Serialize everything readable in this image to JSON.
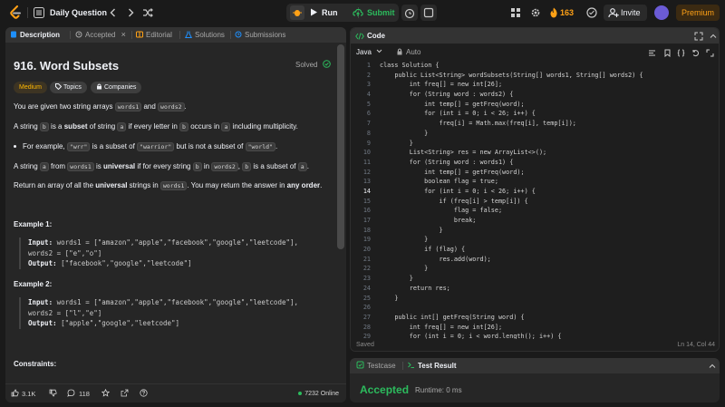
{
  "topbar": {
    "title": "Daily Question",
    "run_label": "Run",
    "submit_label": "Submit",
    "streak": "163",
    "invite_label": "Invite",
    "premium_label": "Premium"
  },
  "left_tabs": [
    {
      "label": "Description"
    },
    {
      "label": "Accepted"
    },
    {
      "label": "Editorial"
    },
    {
      "label": "Solutions"
    },
    {
      "label": "Submissions"
    }
  ],
  "close_glyph": "×",
  "problem": {
    "title": "916. Word Subsets",
    "status": "Solved",
    "difficulty": "Medium",
    "topics_label": "Topics",
    "companies_label": "Companies",
    "p1_a": "You are given two string arrays ",
    "p1_b": "words1",
    "p1_c": " and ",
    "p1_d": "words2",
    "p1_e": ".",
    "p2_a": "A string ",
    "p2_b": "b",
    "p2_c": " is a ",
    "p2_d": "subset",
    "p2_e": " of string ",
    "p2_f": "a",
    "p2_g": " if every letter in ",
    "p2_h": "b",
    "p2_i": " occurs in ",
    "p2_j": "a",
    "p2_k": " including multiplicity.",
    "bullet_a": "For example, ",
    "bullet_b": "\"wrr\"",
    "bullet_c": " is a subset of ",
    "bullet_d": "\"warrior\"",
    "bullet_e": " but is not a subset of ",
    "bullet_f": "\"world\"",
    "bullet_g": ".",
    "p3_a": "A string ",
    "p3_b": "a",
    "p3_c": " from ",
    "p3_d": "words1",
    "p3_e": " is ",
    "p3_f": "universal",
    "p3_g": " if for every string ",
    "p3_h": "b",
    "p3_i": " in ",
    "p3_j": "words2",
    "p3_k": ", ",
    "p3_l": "b",
    "p3_m": " is a subset of ",
    "p3_n": "a",
    "p3_o": ".",
    "p4_a": "Return an array of all the ",
    "p4_b": "universal",
    "p4_c": " strings in ",
    "p4_d": "words1",
    "p4_e": ". You may return the answer in ",
    "p4_f": "any order",
    "p4_g": ".",
    "example1_title": "Example 1:",
    "example1_input_label": "Input:",
    "example1_input_1": " words1 = [\"amazon\",\"apple\",\"facebook\",\"google\",\"leetcode\"],",
    "example1_input_2": "words2 = [\"e\",\"o\"]",
    "example1_output_label": "Output:",
    "example1_output": " [\"facebook\",\"google\",\"leetcode\"]",
    "example2_title": "Example 2:",
    "example2_input_label": "Input:",
    "example2_input_1": " words1 = [\"amazon\",\"apple\",\"facebook\",\"google\",\"leetcode\"],",
    "example2_input_2": "words2 = [\"l\",\"e\"]",
    "example2_output_label": "Output:",
    "example2_output": " [\"apple\",\"google\",\"leetcode\"]",
    "constraints_title": "Constraints:"
  },
  "footer": {
    "likes": "3.1K",
    "comments": "118",
    "online": "7232 Online"
  },
  "code": {
    "header_label": "Code",
    "language": "Java",
    "auto_label": "Auto",
    "current_line": 14,
    "line_numbers": [
      "1",
      "2",
      "3",
      "4",
      "5",
      "6",
      "7",
      "8",
      "9",
      "10",
      "11",
      "12",
      "13",
      "14",
      "15",
      "16",
      "17",
      "18",
      "19",
      "20",
      "21",
      "22",
      "23",
      "24",
      "25",
      "26",
      "27",
      "28",
      "29"
    ],
    "lines": [
      "class Solution {",
      "    public List<String> wordSubsets(String[] words1, String[] words2) {",
      "        int freq[] = new int[26];",
      "        for (String word : words2) {",
      "            int temp[] = getFreq(word);",
      "            for (int i = 0; i < 26; i++) {",
      "                freq[i] = Math.max(freq[i], temp[i]);",
      "            }",
      "        }",
      "        List<String> res = new ArrayList<>();",
      "        for (String word : words1) {",
      "            int temp[] = getFreq(word);",
      "            boolean flag = true;",
      "            for (int i = 0; i < 26; i++) {",
      "                if (freq[i] > temp[i]) {",
      "                    flag = false;",
      "                    break;",
      "                }",
      "            }",
      "            if (flag) {",
      "                res.add(word);",
      "            }",
      "        }",
      "        return res;",
      "    }",
      "",
      "    public int[] getFreq(String word) {",
      "        int freq[] = new int[26];",
      "        for (int i = 0; i < word.length(); i++) {"
    ],
    "status_saved": "Saved",
    "cursor_position": "Ln 14, Col 44"
  },
  "bottom": {
    "testcase_label": "Testcase",
    "result_label": "Test Result",
    "verdict": "Accepted",
    "runtime": "Runtime: 0 ms"
  },
  "colors": {
    "accent_green": "#2cbb5d",
    "brand_orange": "#ffa116",
    "medium_yellow": "#ffb800"
  }
}
